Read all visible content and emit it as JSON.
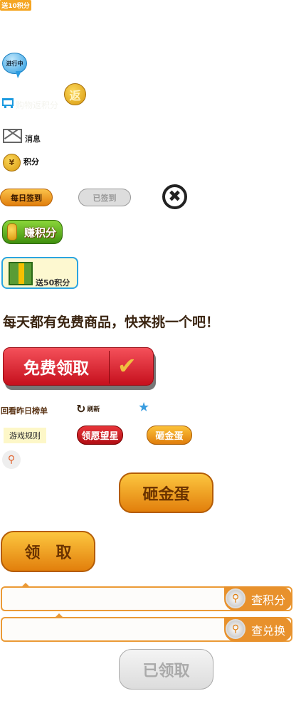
{
  "badge_10": "送10积分",
  "in_progress": "进行中",
  "cart_text": "购物返积分",
  "return_coin": "返",
  "messages": "消息",
  "yen": "¥",
  "points": "积分",
  "daily_sign": "每日签到",
  "signed": "已签到",
  "close": "✖",
  "earn_points": "赚积分",
  "gift_label": "送50积分",
  "headline": "每天都有免费商品，快来挑一个吧！",
  "free_claim": "免费领取",
  "check": "✔",
  "yesterday_rank": "回看昨日榜单",
  "refresh": "刷新",
  "refresh_glyph": "↻",
  "star": "★",
  "game_rules": "游戏规则",
  "claim_star": "领愿望星",
  "smash_egg_small": "砸金蛋",
  "search_glyph": "⚲",
  "smash_egg_big": "砸金蛋",
  "claim": "领　取",
  "query_points": "查积分",
  "query_exchange": "查兑换",
  "claimed": "已领取"
}
